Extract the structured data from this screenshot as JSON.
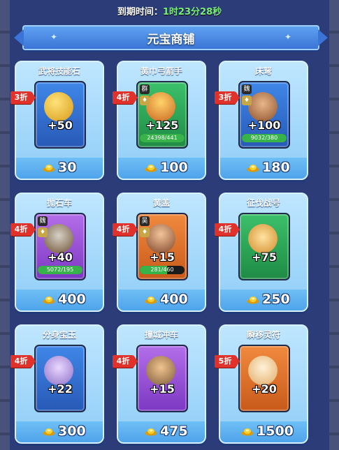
{
  "timer": {
    "label": "到期时间：",
    "value": "1时23分28秒"
  },
  "shop": {
    "title": "元宝商铺"
  },
  "items": [
    {
      "name": "武将技能石",
      "discount": "3折",
      "amount": "+50",
      "price": "30",
      "rarity": "blue",
      "icon": "skill-stone-icon"
    },
    {
      "name": "黄巾弓箭手",
      "discount": "4折",
      "amount": "+125",
      "price": "100",
      "rarity": "green",
      "icon": "archer-hero-icon",
      "faction": "群",
      "progress": "24398/441",
      "progress_fraction": 1.0
    },
    {
      "name": "床弩",
      "discount": "3折",
      "amount": "+100",
      "price": "180",
      "rarity": "blue",
      "icon": "ballista-icon",
      "faction": "魏",
      "progress": "9032/380",
      "progress_fraction": 1.0
    },
    {
      "name": "抛石车",
      "discount": "4折",
      "amount": "+40",
      "price": "400",
      "rarity": "purple",
      "icon": "catapult-icon",
      "faction": "魏",
      "progress": "5072/195",
      "progress_fraction": 1.0
    },
    {
      "name": "黄盖",
      "discount": "4折",
      "amount": "+15",
      "price": "400",
      "rarity": "orange",
      "icon": "huang-gai-hero-icon",
      "faction": "吴",
      "progress": "281/460",
      "progress_fraction": 0.61
    },
    {
      "name": "征伐战号",
      "discount": "4折",
      "amount": "+75",
      "price": "250",
      "rarity": "green",
      "icon": "war-horn-icon"
    },
    {
      "name": "分身宝玉",
      "discount": "4折",
      "amount": "+22",
      "price": "300",
      "rarity": "blue",
      "icon": "jade-gem-icon"
    },
    {
      "name": "撞城冲车",
      "discount": "4折",
      "amount": "+15",
      "price": "475",
      "rarity": "purple",
      "icon": "battering-ram-icon"
    },
    {
      "name": "瞬移灵符",
      "discount": "5折",
      "amount": "+20",
      "price": "1500",
      "rarity": "orange",
      "icon": "teleport-talisman-icon"
    }
  ],
  "colors": {
    "discount_tag": "#e0322a",
    "timer_value": "#7cf07a",
    "card_bg": "#8fcdf7",
    "currency": "#f3c21a"
  },
  "currency_icon": "gold-ingot-icon"
}
